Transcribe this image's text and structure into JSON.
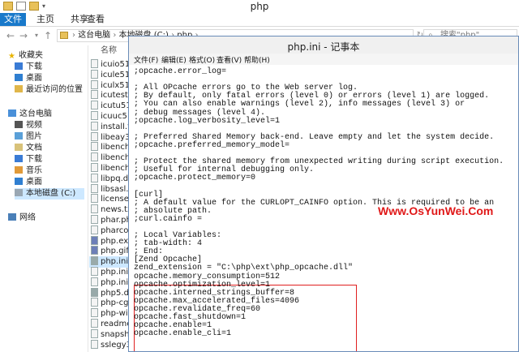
{
  "explorer": {
    "title": "php",
    "ribbon_tabs": [
      "文件",
      "主页",
      "共享",
      "查看"
    ],
    "address_path": [
      "这台电脑",
      "本地磁盘 (C:)",
      "php"
    ],
    "search_placeholder": "搜索\"php\"",
    "column_header": "名称",
    "nav": {
      "favorites": "收藏夹",
      "fav_items": [
        "下载",
        "桌面",
        "最近访问的位置"
      ],
      "this_pc": "这台电脑",
      "pc_items": [
        "视频",
        "图片",
        "文档",
        "下载",
        "音乐",
        "桌面",
        "本地磁盘 (C:)"
      ],
      "network": "网络"
    },
    "files": [
      "icuio51.d",
      "icule51.dl",
      "iculx51.dl",
      "icutest51",
      "icutu51.dl",
      "icuuc51.dl",
      "install.txt",
      "libeay32.",
      "libenchar",
      "libenchar",
      "libenchar",
      "libpq.dll",
      "libsasl.dl",
      "license.tx",
      "news.txt",
      "phar.pha",
      "pharcom",
      "php.exe",
      "php.gif",
      "php.ini",
      "php.ini-d",
      "php.ini-p",
      "php5.dll",
      "php-cgi.e",
      "php-win.e",
      "readme-",
      "snapshot",
      "sslegy32"
    ]
  },
  "notepad": {
    "title": "php.ini - 记事本",
    "menu": [
      "文件(F)",
      "编辑(E)",
      "格式(O)",
      "查看(V)",
      "帮助(H)"
    ],
    "lines": [
      ";opcache.error_log=",
      "",
      "; All OPcache errors go to the Web server log.",
      "; By default, only fatal errors (level 0) or errors (level 1) are logged.",
      "; You can also enable warnings (level 2), info messages (level 3) or",
      "; debug messages (level 4).",
      ";opcache.log_verbosity_level=1",
      "",
      "; Preferred Shared Memory back-end. Leave empty and let the system decide.",
      ";opcache.preferred_memory_model=",
      "",
      "; Protect the shared memory from unexpected writing during script execution.",
      "; Useful for internal debugging only.",
      ";opcache.protect_memory=0",
      "",
      "[curl]",
      "; A default value for the CURLOPT_CAINFO option. This is required to be an",
      "; absolute path.",
      ";curl.cainfo =",
      "",
      "; Local Variables:",
      "; tab-width: 4",
      "; End:",
      "[Zend Opcache]",
      "zend_extension = \"C:\\php\\ext\\php_opcache.dll\"",
      "opcache.memory_consumption=512",
      "opcache.optimization_level=1",
      "opcache.interned_strings_buffer=8",
      "opcache.max_accelerated_files=4096",
      "opcache.revalidate_freq=60",
      "opcache.fast_shutdown=1",
      "opcache.enable=1",
      "opcache.enable_cli=1"
    ],
    "watermark": "Www.OsYunWei.Com"
  },
  "colors": {
    "accent": "#1979ca",
    "highlight": "#e02020",
    "watermark": "#e01818"
  }
}
